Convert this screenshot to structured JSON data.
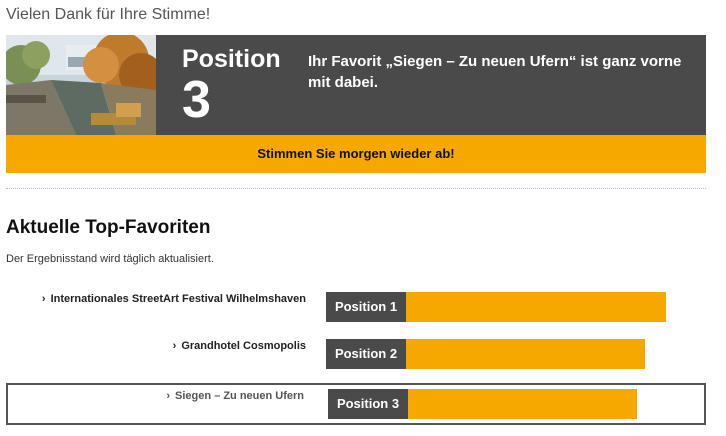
{
  "header": {
    "thanks": "Vielen Dank für Ihre Stimme!"
  },
  "banner": {
    "position_word": "Position",
    "position_number": "3",
    "favorite_text": "Ihr Favorit „Siegen – Zu neuen Ufern“ ist ganz vorne mit dabei."
  },
  "cta": {
    "label": "Stimmen Sie morgen wieder ab!"
  },
  "section": {
    "title": "Aktuelle Top-Favoriten",
    "subtitle": "Der Ergebnisstand wird täglich aktualisiert."
  },
  "ranking": [
    {
      "name": "Internationales StreetArt Festival Wilhelmshaven",
      "position": "Position 1",
      "share": 1.0,
      "selected": false
    },
    {
      "name": "Grandhotel Cosmopolis",
      "position": "Position 2",
      "share": 0.92,
      "selected": false
    },
    {
      "name": "Siegen – Zu neuen Ufern",
      "position": "Position 3",
      "share": 0.88,
      "selected": true
    }
  ],
  "colors": {
    "accent": "#f7a800",
    "dark": "#4a4a4a"
  }
}
